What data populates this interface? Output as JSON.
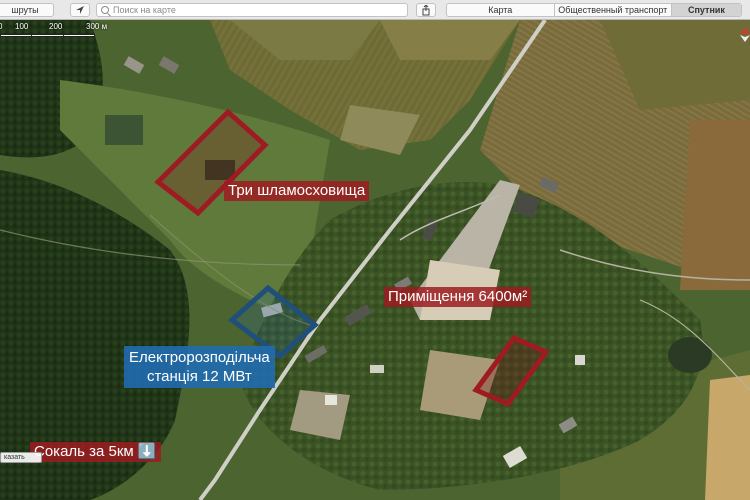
{
  "toolbar": {
    "routes_label": "шруты",
    "search_placeholder": "Поиск на карте",
    "tabs": [
      {
        "label": "Карта",
        "active": false
      },
      {
        "label": "Общественный транспорт",
        "active": false
      },
      {
        "label": "Спутник",
        "active": true
      }
    ]
  },
  "scale": {
    "ticks": [
      "0",
      "100",
      "200",
      "300 м"
    ]
  },
  "annotations": {
    "sludge": "Три шламосховища",
    "building": "Приміщення 6400м²",
    "substation_line1": "Електророзподільча",
    "substation_line2": "станція 12 МВт",
    "sokal": "Сокаль за 5км ⬇️"
  },
  "bottom": {
    "show_label": "казать"
  },
  "colors": {
    "red_box": "#9e1c21",
    "blue_box": "#206cb0",
    "road": "#cfcfc6"
  }
}
